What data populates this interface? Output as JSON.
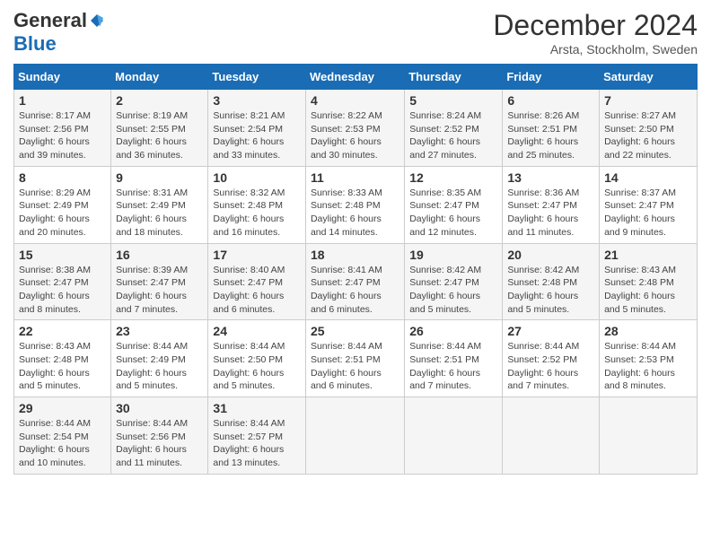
{
  "logo": {
    "general": "General",
    "blue": "Blue"
  },
  "header": {
    "title": "December 2024",
    "subtitle": "Arsta, Stockholm, Sweden"
  },
  "days_of_week": [
    "Sunday",
    "Monday",
    "Tuesday",
    "Wednesday",
    "Thursday",
    "Friday",
    "Saturday"
  ],
  "weeks": [
    [
      {
        "day": "1",
        "info": "Sunrise: 8:17 AM\nSunset: 2:56 PM\nDaylight: 6 hours\nand 39 minutes."
      },
      {
        "day": "2",
        "info": "Sunrise: 8:19 AM\nSunset: 2:55 PM\nDaylight: 6 hours\nand 36 minutes."
      },
      {
        "day": "3",
        "info": "Sunrise: 8:21 AM\nSunset: 2:54 PM\nDaylight: 6 hours\nand 33 minutes."
      },
      {
        "day": "4",
        "info": "Sunrise: 8:22 AM\nSunset: 2:53 PM\nDaylight: 6 hours\nand 30 minutes."
      },
      {
        "day": "5",
        "info": "Sunrise: 8:24 AM\nSunset: 2:52 PM\nDaylight: 6 hours\nand 27 minutes."
      },
      {
        "day": "6",
        "info": "Sunrise: 8:26 AM\nSunset: 2:51 PM\nDaylight: 6 hours\nand 25 minutes."
      },
      {
        "day": "7",
        "info": "Sunrise: 8:27 AM\nSunset: 2:50 PM\nDaylight: 6 hours\nand 22 minutes."
      }
    ],
    [
      {
        "day": "8",
        "info": "Sunrise: 8:29 AM\nSunset: 2:49 PM\nDaylight: 6 hours\nand 20 minutes."
      },
      {
        "day": "9",
        "info": "Sunrise: 8:31 AM\nSunset: 2:49 PM\nDaylight: 6 hours\nand 18 minutes."
      },
      {
        "day": "10",
        "info": "Sunrise: 8:32 AM\nSunset: 2:48 PM\nDaylight: 6 hours\nand 16 minutes."
      },
      {
        "day": "11",
        "info": "Sunrise: 8:33 AM\nSunset: 2:48 PM\nDaylight: 6 hours\nand 14 minutes."
      },
      {
        "day": "12",
        "info": "Sunrise: 8:35 AM\nSunset: 2:47 PM\nDaylight: 6 hours\nand 12 minutes."
      },
      {
        "day": "13",
        "info": "Sunrise: 8:36 AM\nSunset: 2:47 PM\nDaylight: 6 hours\nand 11 minutes."
      },
      {
        "day": "14",
        "info": "Sunrise: 8:37 AM\nSunset: 2:47 PM\nDaylight: 6 hours\nand 9 minutes."
      }
    ],
    [
      {
        "day": "15",
        "info": "Sunrise: 8:38 AM\nSunset: 2:47 PM\nDaylight: 6 hours\nand 8 minutes."
      },
      {
        "day": "16",
        "info": "Sunrise: 8:39 AM\nSunset: 2:47 PM\nDaylight: 6 hours\nand 7 minutes."
      },
      {
        "day": "17",
        "info": "Sunrise: 8:40 AM\nSunset: 2:47 PM\nDaylight: 6 hours\nand 6 minutes."
      },
      {
        "day": "18",
        "info": "Sunrise: 8:41 AM\nSunset: 2:47 PM\nDaylight: 6 hours\nand 6 minutes."
      },
      {
        "day": "19",
        "info": "Sunrise: 8:42 AM\nSunset: 2:47 PM\nDaylight: 6 hours\nand 5 minutes."
      },
      {
        "day": "20",
        "info": "Sunrise: 8:42 AM\nSunset: 2:48 PM\nDaylight: 6 hours\nand 5 minutes."
      },
      {
        "day": "21",
        "info": "Sunrise: 8:43 AM\nSunset: 2:48 PM\nDaylight: 6 hours\nand 5 minutes."
      }
    ],
    [
      {
        "day": "22",
        "info": "Sunrise: 8:43 AM\nSunset: 2:48 PM\nDaylight: 6 hours\nand 5 minutes."
      },
      {
        "day": "23",
        "info": "Sunrise: 8:44 AM\nSunset: 2:49 PM\nDaylight: 6 hours\nand 5 minutes."
      },
      {
        "day": "24",
        "info": "Sunrise: 8:44 AM\nSunset: 2:50 PM\nDaylight: 6 hours\nand 5 minutes."
      },
      {
        "day": "25",
        "info": "Sunrise: 8:44 AM\nSunset: 2:51 PM\nDaylight: 6 hours\nand 6 minutes."
      },
      {
        "day": "26",
        "info": "Sunrise: 8:44 AM\nSunset: 2:51 PM\nDaylight: 6 hours\nand 7 minutes."
      },
      {
        "day": "27",
        "info": "Sunrise: 8:44 AM\nSunset: 2:52 PM\nDaylight: 6 hours\nand 7 minutes."
      },
      {
        "day": "28",
        "info": "Sunrise: 8:44 AM\nSunset: 2:53 PM\nDaylight: 6 hours\nand 8 minutes."
      }
    ],
    [
      {
        "day": "29",
        "info": "Sunrise: 8:44 AM\nSunset: 2:54 PM\nDaylight: 6 hours\nand 10 minutes."
      },
      {
        "day": "30",
        "info": "Sunrise: 8:44 AM\nSunset: 2:56 PM\nDaylight: 6 hours\nand 11 minutes."
      },
      {
        "day": "31",
        "info": "Sunrise: 8:44 AM\nSunset: 2:57 PM\nDaylight: 6 hours\nand 13 minutes."
      },
      {
        "day": "",
        "info": ""
      },
      {
        "day": "",
        "info": ""
      },
      {
        "day": "",
        "info": ""
      },
      {
        "day": "",
        "info": ""
      }
    ]
  ]
}
